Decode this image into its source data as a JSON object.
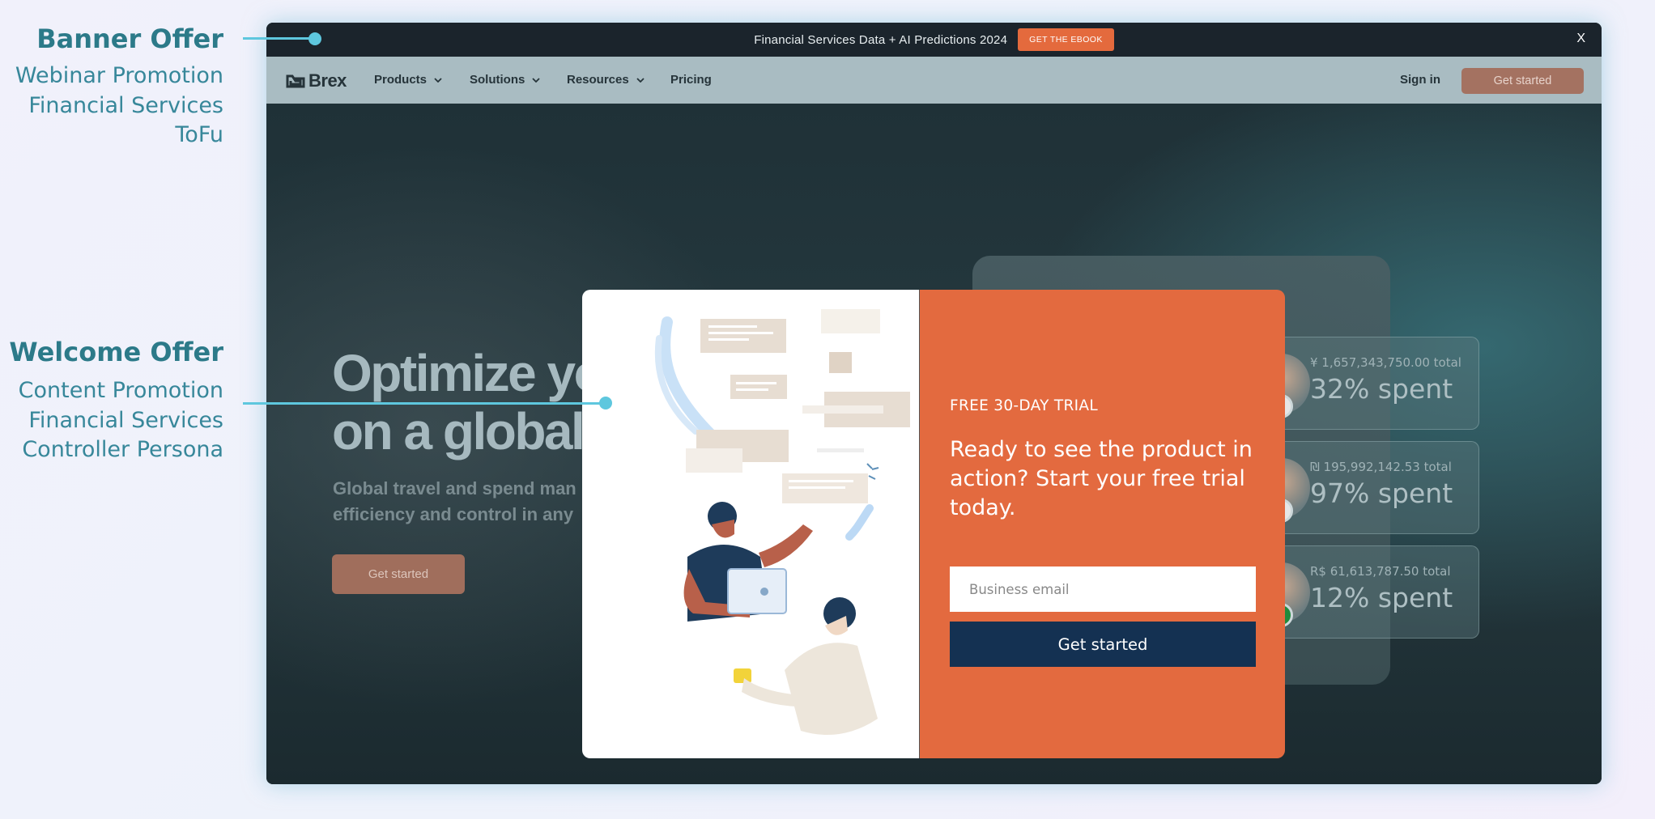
{
  "annotations": [
    {
      "heading": "Banner Offer",
      "lines": [
        "Webinar Promotion",
        "Financial Services",
        "ToFu"
      ]
    },
    {
      "heading": "Welcome Offer",
      "lines": [
        "Content Promotion",
        "Financial Services",
        "Controller Persona"
      ]
    }
  ],
  "banner": {
    "text": "Financial Services Data + AI Predictions 2024",
    "button": "GET THE EBOOK",
    "close": "X"
  },
  "nav": {
    "logo": "Brex",
    "items": [
      {
        "label": "Products"
      },
      {
        "label": "Solutions"
      },
      {
        "label": "Resources"
      },
      {
        "label": "Pricing"
      }
    ],
    "sign_in": "Sign in",
    "cta": "Get started"
  },
  "hero": {
    "title_line1": "Optimize yo",
    "title_line2": "on a global",
    "subtitle_line1": "Global travel and spend man",
    "subtitle_line2": "efficiency and control in any",
    "cta": "Get started"
  },
  "stats": [
    {
      "total": "¥ 1,657,343,750.00 total",
      "pct": "32% spent"
    },
    {
      "total": "₪ 195,992,142.53 total",
      "pct": "97% spent"
    },
    {
      "total": "R$ 61,613,787.50 total",
      "pct": "12% spent"
    }
  ],
  "modal": {
    "label": "FREE 30-DAY TRIAL",
    "heading": "Ready to see the product in action? Start your free trial today.",
    "email_placeholder": "Business email",
    "submit": "Get started"
  },
  "colors": {
    "accent_orange": "#e36a3f",
    "navy": "#143152",
    "annotation_teal": "#2c7a89",
    "connector": "#5ec7de"
  }
}
